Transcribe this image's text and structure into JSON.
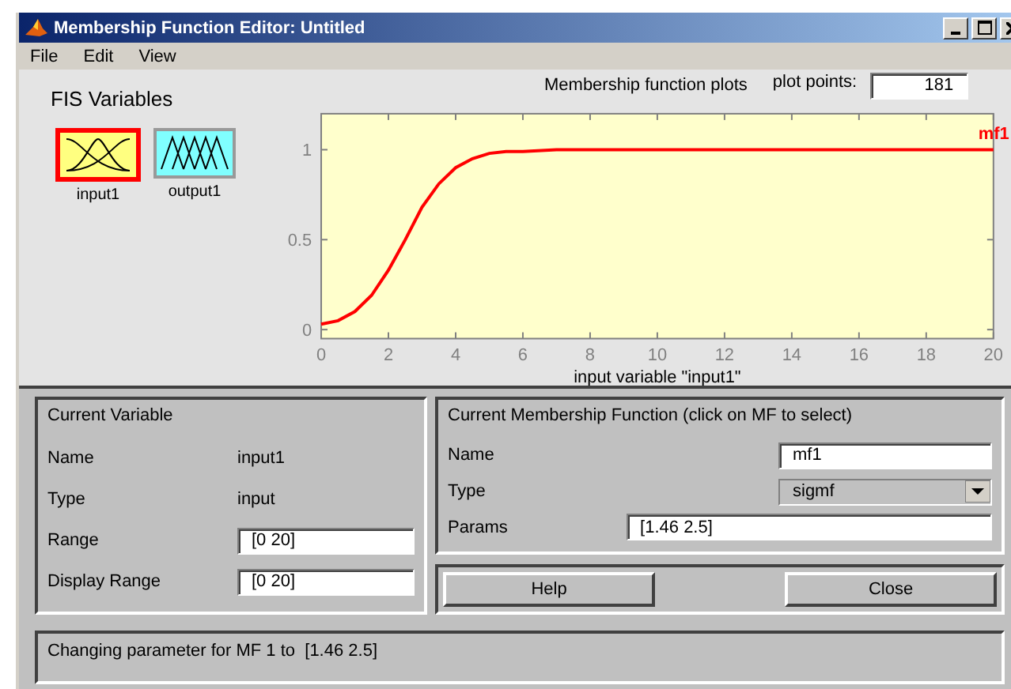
{
  "window": {
    "title": "Membership Function Editor: Untitled"
  },
  "menu": [
    "File",
    "Edit",
    "View"
  ],
  "fis_variables": {
    "title": "FIS Variables",
    "items": [
      {
        "label": "input1",
        "kind": "input",
        "selected": true
      },
      {
        "label": "output1",
        "kind": "output",
        "selected": false
      }
    ]
  },
  "plot": {
    "title": "Membership function plots",
    "plot_points_label": "plot points:",
    "plot_points": "181",
    "chart_data": {
      "type": "line",
      "xlabel": "input variable \"input1\"",
      "x": [
        0,
        0.5,
        1,
        1.5,
        2,
        2.5,
        3,
        3.5,
        4,
        4.5,
        5,
        5.5,
        6,
        7,
        8,
        9,
        10,
        12,
        14,
        16,
        18,
        20
      ],
      "series": [
        {
          "name": "mf1",
          "color": "#ff0000",
          "values": [
            0.03,
            0.05,
            0.1,
            0.19,
            0.33,
            0.5,
            0.68,
            0.81,
            0.9,
            0.95,
            0.98,
            0.99,
            0.99,
            1,
            1,
            1,
            1,
            1,
            1,
            1,
            1,
            1
          ]
        }
      ],
      "xlim": [
        0,
        20
      ],
      "ylim": [
        -0.05,
        1.2
      ],
      "xticks": [
        0,
        2,
        4,
        6,
        8,
        10,
        12,
        14,
        16,
        18,
        20
      ],
      "yticks": [
        0,
        0.5,
        1
      ]
    }
  },
  "current_variable": {
    "title": "Current Variable",
    "name_label": "Name",
    "name": "input1",
    "type_label": "Type",
    "type": "input",
    "range_label": "Range",
    "range": "[0 20]",
    "display_range_label": "Display Range",
    "display_range": "[0 20]"
  },
  "current_mf": {
    "title": "Current Membership Function (click on MF to select)",
    "name_label": "Name",
    "name": "mf1",
    "type_label": "Type",
    "type": "sigmf",
    "params_label": "Params",
    "params": "[1.46 2.5]"
  },
  "buttons": [
    "Help",
    "Close"
  ],
  "status": "Changing parameter for MF 1 to  [1.46 2.5]"
}
